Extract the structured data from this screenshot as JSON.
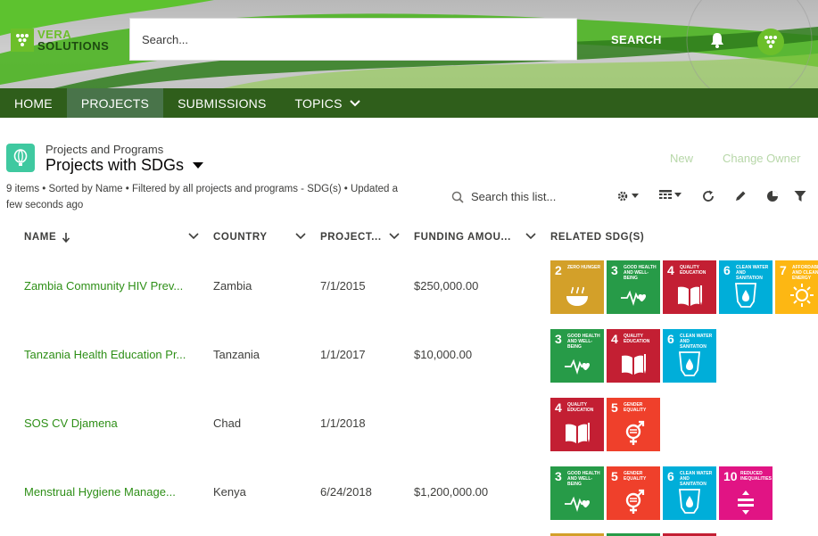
{
  "header": {
    "logo_line1": "VERA",
    "logo_line2": "SOLUTIONS",
    "search_placeholder": "Search...",
    "search_button": "SEARCH"
  },
  "nav": {
    "items": [
      {
        "label": "HOME"
      },
      {
        "label": "PROJECTS"
      },
      {
        "label": "SUBMISSIONS"
      },
      {
        "label": "TOPICS"
      }
    ],
    "active": "PROJECTS"
  },
  "list": {
    "object_type": "Projects and Programs",
    "title": "Projects with SDGs",
    "meta": "9 items • Sorted by Name • Filtered by all projects and programs - SDG(s) • Updated a few seconds ago",
    "search_placeholder": "Search this list...",
    "actions": {
      "new": "New",
      "change_owner": "Change Owner"
    }
  },
  "table": {
    "columns": [
      "NAME",
      "COUNTRY",
      "PROJECT...",
      "FUNDING AMOU...",
      "RELATED SDG(S)"
    ],
    "rows": [
      {
        "name": "Zambia Community HIV Prev...",
        "country": "Zambia",
        "date": "7/1/2015",
        "funding": "$250,000.00",
        "sdgs": [
          2,
          3,
          4,
          6,
          7
        ]
      },
      {
        "name": "Tanzania Health Education Pr...",
        "country": "Tanzania",
        "date": "1/1/2017",
        "funding": "$10,000.00",
        "sdgs": [
          3,
          4,
          6
        ]
      },
      {
        "name": "SOS CV Djamena",
        "country": "Chad",
        "date": "1/1/2018",
        "funding": "",
        "sdgs": [
          4,
          5
        ]
      },
      {
        "name": "Menstrual Hygiene Manage...",
        "country": "Kenya",
        "date": "6/24/2018",
        "funding": "$1,200,000.00",
        "sdgs": [
          3,
          5,
          6,
          10
        ]
      }
    ]
  },
  "sdg_catalog": {
    "2": {
      "label": "ZERO HUNGER",
      "color": "#d3a029",
      "icon": "bowl-icon"
    },
    "3": {
      "label": "GOOD HEALTH AND WELL-BEING",
      "color": "#279b48",
      "icon": "heartbeat-icon"
    },
    "4": {
      "label": "QUALITY EDUCATION",
      "color": "#c31f33",
      "icon": "book-icon"
    },
    "5": {
      "label": "GENDER EQUALITY",
      "color": "#ef402b",
      "icon": "gender-icon"
    },
    "6": {
      "label": "CLEAN WATER AND SANITATION",
      "color": "#00aed9",
      "icon": "water-drop-icon"
    },
    "7": {
      "label": "AFFORDABLE AND CLEAN ENERGY",
      "color": "#fdb713",
      "icon": "sun-icon"
    },
    "10": {
      "label": "REDUCED INEQUALITIES",
      "color": "#e11484",
      "icon": "equality-icon"
    }
  },
  "colors": {
    "nav_bg": "#2f5e1b",
    "nav_active": "#49744a",
    "link": "#2e8f17",
    "brand_green": "#6cbf2a"
  }
}
